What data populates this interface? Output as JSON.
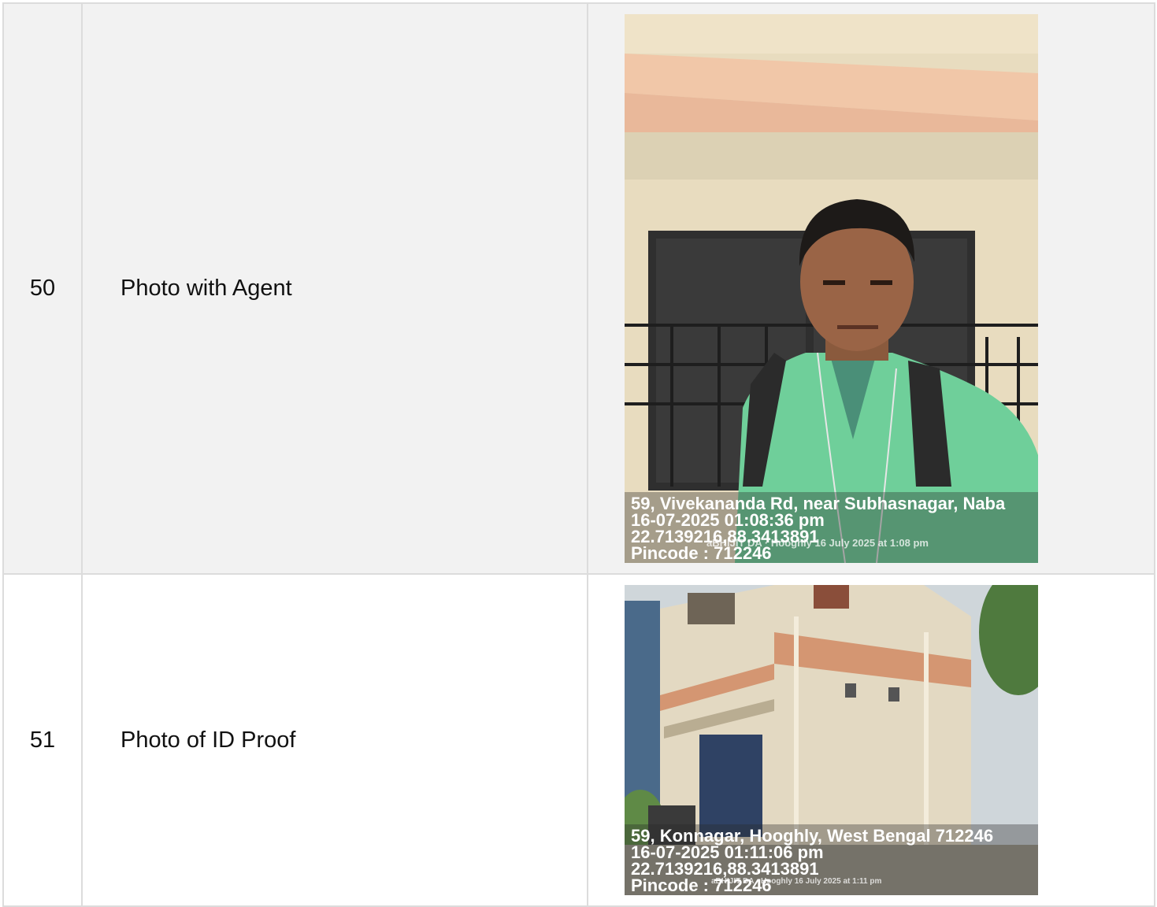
{
  "rows": [
    {
      "sn": "50",
      "label": "Photo with Agent",
      "photo": {
        "description_icon": "selfie-photo",
        "stamp_lines": [
          "59, Vivekananda Rd, near Subhasnagar, Naba",
          "16-07-2025 01:08:36 pm",
          "22.7139216,88.3413891",
          "Pincode : 712246"
        ],
        "watermark": "aBHIJIT DA · Hooghly   16 July 2025 at 1:08 pm"
      }
    },
    {
      "sn": "51",
      "label": "Photo of ID Proof",
      "photo": {
        "description_icon": "building-photo",
        "stamp_lines": [
          "59, Konnagar, Hooghly, West Bengal 712246",
          "16-07-2025 01:11:06 pm",
          "22.7139216,88.3413891",
          "Pincode : 712246"
        ],
        "watermark": "aBHIJIT DA · Hooghly   16 July 2025 at 1:11 pm"
      }
    }
  ],
  "colors": {
    "row_alt_bg": "#f2f2f2",
    "border": "#dcdcdc",
    "shirt_green": "#6fcf9a"
  }
}
